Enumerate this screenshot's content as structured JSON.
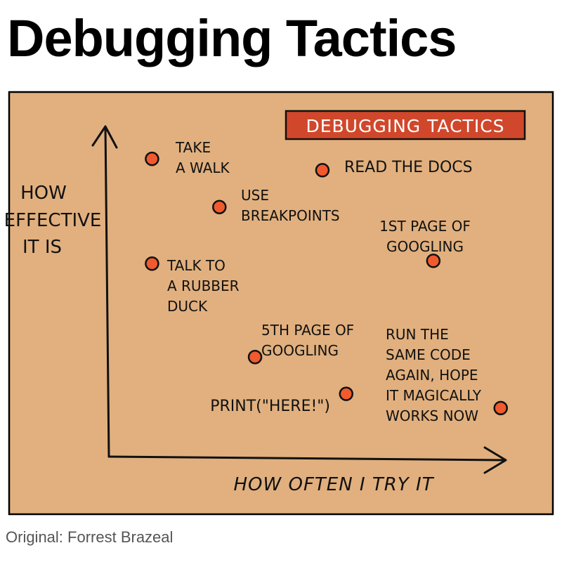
{
  "page_title": "Debugging Tactics",
  "credit": "Original: Forrest Brazeal",
  "colors": {
    "background": "#e1b07e",
    "border": "#000000",
    "badge": "#d1472b",
    "badge_text": "#ffffff",
    "dot_fill": "#f05a2e",
    "dot_stroke": "#111111"
  },
  "chart_data": {
    "type": "scatter",
    "title": "DEBUGGING TACTICS",
    "xlabel": "HOW OFTEN I TRY IT",
    "ylabel": [
      "HOW",
      "EFFECTIVE",
      "IT IS"
    ],
    "xlim": [
      0,
      100
    ],
    "ylim": [
      0,
      100
    ],
    "grid": false,
    "legend": "none",
    "points": [
      {
        "label": [
          "TAKE",
          "A WALK"
        ],
        "x": 10,
        "y": 94
      },
      {
        "label": [
          "READ THE DOCS"
        ],
        "x": 53,
        "y": 90
      },
      {
        "label": [
          "USE",
          "BREAKPOINTS"
        ],
        "x": 27,
        "y": 77
      },
      {
        "label": [
          "1ST PAGE OF",
          "GOOGLING"
        ],
        "x": 81,
        "y": 58
      },
      {
        "label": [
          "TALK TO",
          "A RUBBER",
          "DUCK"
        ],
        "x": 10,
        "y": 57
      },
      {
        "label": [
          "5TH PAGE OF",
          "GOOGLING"
        ],
        "x": 36,
        "y": 24
      },
      {
        "label": [
          "PRINT(\"HERE!\")"
        ],
        "x": 59,
        "y": 11
      },
      {
        "label": [
          "RUN THE",
          "SAME CODE",
          "AGAIN, HOPE",
          "IT MAGICALLY",
          "WORKS NOW"
        ],
        "x": 98,
        "y": 6
      }
    ]
  }
}
